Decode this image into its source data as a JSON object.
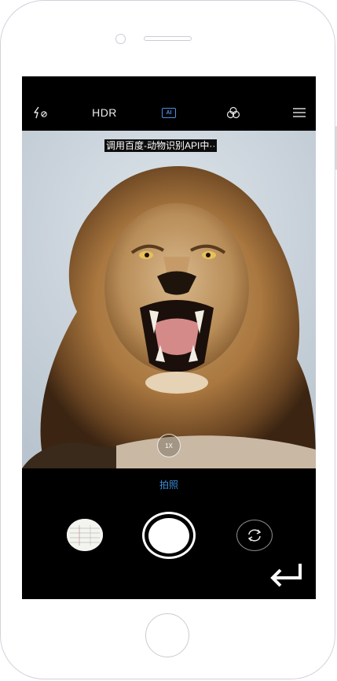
{
  "camera": {
    "top_bar": {
      "flash_icon": "flash-off-icon",
      "hdr_label": "HDR",
      "ai_label": "AI",
      "ai_color": "#4a90e2",
      "filter_icon": "filters-icon",
      "menu_icon": "menu-icon"
    },
    "viewfinder": {
      "status_text": "调用百度-动物识别API中··",
      "subject": "lion-photo",
      "zoom_label": "1X"
    },
    "bottom": {
      "mode_label": "拍照",
      "mode_color": "#3d8ddc",
      "gallery_thumbnail": "recent-photo-thumbnail",
      "shutter_icon": "shutter-icon",
      "switch_camera_icon": "switch-camera-icon",
      "back_icon": "return-arrow-icon"
    }
  }
}
